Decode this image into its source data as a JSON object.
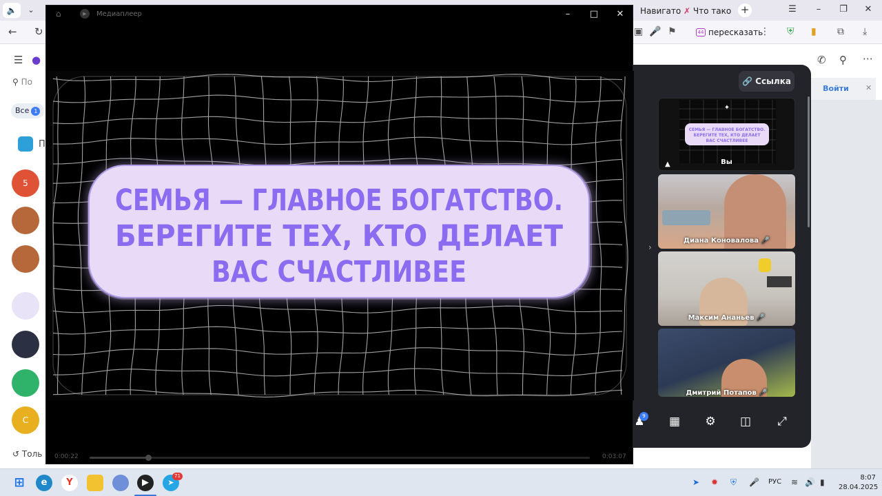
{
  "browser": {
    "tabs": [
      {
        "label": "Навигато"
      },
      {
        "label": "Что тако"
      }
    ],
    "retell_label": "пересказать",
    "retell_badge": "44"
  },
  "messenger": {
    "search_placeholder": "По",
    "filter_all": "Все",
    "filter_all_count": "1",
    "chat_badge_5": "5",
    "chat_avatar_c": "С",
    "footer_text": "Толь",
    "section_label": "П"
  },
  "call": {
    "link_button": "Ссылка",
    "login_button": "Войти",
    "participants_count": "9",
    "participants": [
      {
        "name": "Вы"
      },
      {
        "name": "Диана Коновалова"
      },
      {
        "name": "Максим Ананьев"
      },
      {
        "name": "Дмитрий Потапов"
      }
    ]
  },
  "player": {
    "title": "Медиаплеер",
    "slide_lines": [
      "СЕМЬЯ — ГЛАВНОЕ БОГАТСТВО.",
      "БЕРЕГИТЕ ТЕХ, КТО ДЕЛАЕТ",
      "ВАС СЧАСТЛИВЕЕ"
    ],
    "time_current": "0:00:22",
    "time_total": "0:03:07",
    "progress_fraction": 0.117
  },
  "taskbar": {
    "telegram_badge": "71",
    "language": "РУС",
    "time": "8:07",
    "date": "28.04.2025"
  },
  "colors": {
    "slide_text": "#8b6cf0",
    "slide_card": "#e9dbf7",
    "accent_blue": "#3b7de0"
  }
}
